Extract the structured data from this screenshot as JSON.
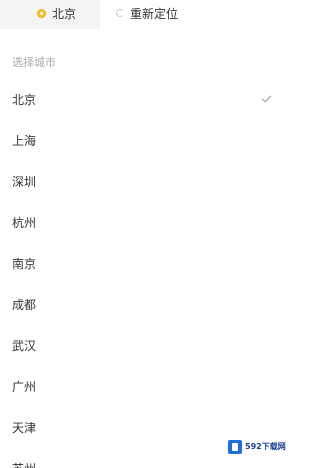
{
  "header": {
    "current_city_label": "北京",
    "relocate_label": "重新定位"
  },
  "section": {
    "title": "选择城市"
  },
  "cities": [
    {
      "name": "北京",
      "selected": true
    },
    {
      "name": "上海",
      "selected": false
    },
    {
      "name": "深圳",
      "selected": false
    },
    {
      "name": "杭州",
      "selected": false
    },
    {
      "name": "南京",
      "selected": false
    },
    {
      "name": "成都",
      "selected": false
    },
    {
      "name": "武汉",
      "selected": false
    },
    {
      "name": "广州",
      "selected": false
    },
    {
      "name": "天津",
      "selected": false
    },
    {
      "name": "苏州",
      "selected": false
    }
  ],
  "watermark": {
    "text": "592下载网"
  },
  "colors": {
    "accent_pin": "#f2c230",
    "text_primary": "#333333",
    "text_secondary": "#aaaaaa",
    "chip_bg": "#f4f4f4"
  },
  "icons": {
    "pin": "location-pin-icon",
    "refresh": "refresh-icon",
    "check": "check-icon"
  }
}
